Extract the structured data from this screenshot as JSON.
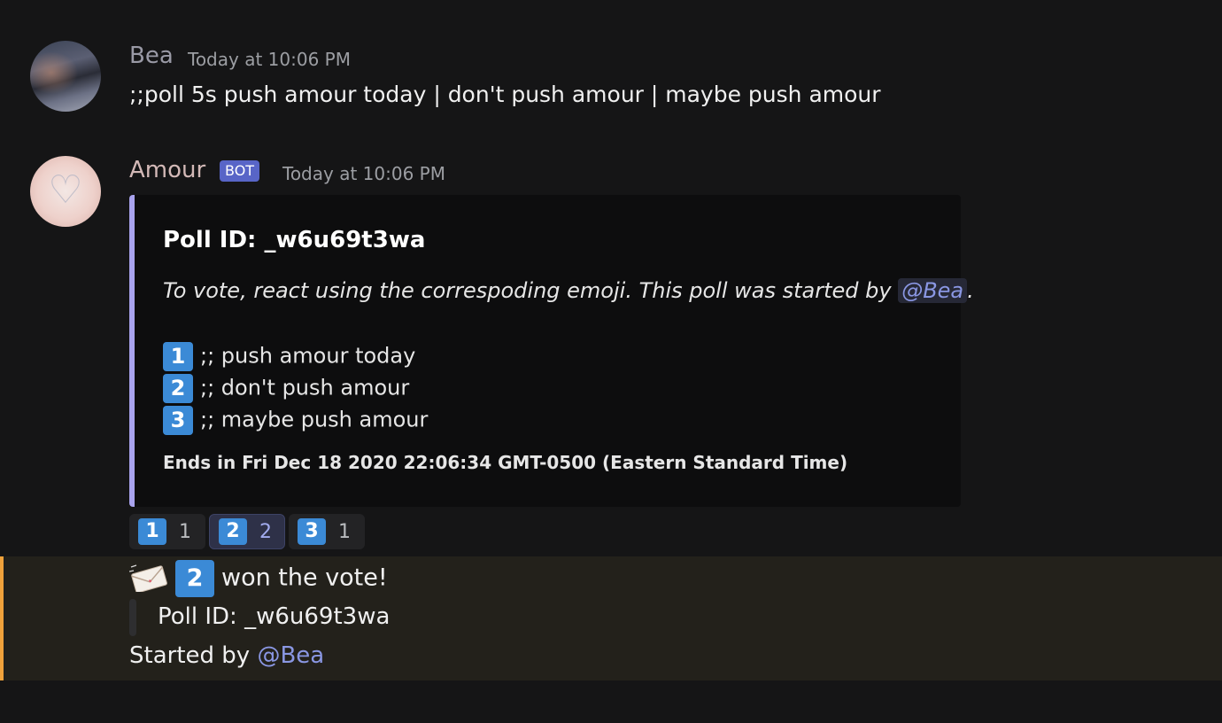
{
  "messages": [
    {
      "author": "Bea",
      "timestamp": "Today at 10:06 PM",
      "content": ";;poll 5s push amour today | don't push amour | maybe push amour"
    },
    {
      "author": "Amour",
      "badge": "BOT",
      "timestamp": "Today at 10:06 PM",
      "embed": {
        "title": "Poll ID: _w6u69t3wa",
        "description_prefix": "To vote, react using the correspoding emoji. This poll was started by ",
        "description_mention": "@Bea",
        "description_suffix": ".",
        "options": [
          {
            "key": "1",
            "text": ";; push amour today"
          },
          {
            "key": "2",
            "text": ";; don't push amour"
          },
          {
            "key": "3",
            "text": ";; maybe push amour"
          }
        ],
        "footer": "Ends in Fri Dec 18 2020 22:06:34 GMT-0500 (Eastern Standard Time)"
      },
      "reactions": [
        {
          "key": "1",
          "count": "1",
          "active": false
        },
        {
          "key": "2",
          "count": "2",
          "active": true
        },
        {
          "key": "3",
          "count": "1",
          "active": false
        }
      ]
    }
  ],
  "result": {
    "icon": "envelope-icon",
    "winner_key": "2",
    "won_text": "won the vote!",
    "poll_id": "Poll ID: _w6u69t3wa",
    "started_by": "Started by ",
    "started_mention": "@Bea"
  },
  "colors": {
    "accent_border": "#a9a3ee",
    "highlight_border": "#f0a23b",
    "keycap": "#3b8ad6",
    "mention": "#8a97e3",
    "bot_badge": "#5865c7"
  }
}
